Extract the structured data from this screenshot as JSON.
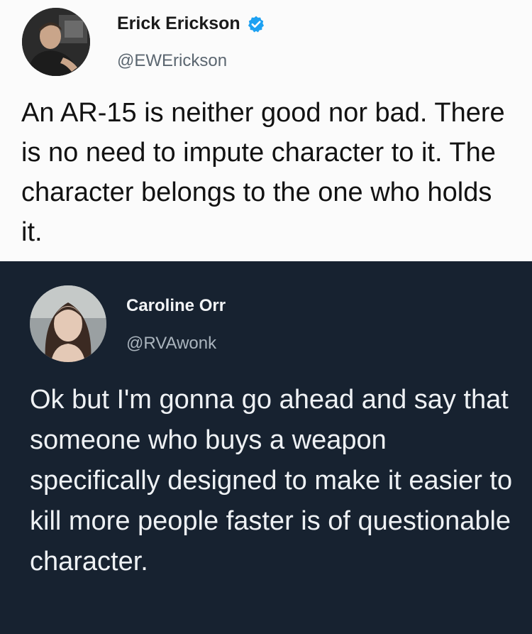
{
  "tweets": [
    {
      "display_name": "Erick Erickson",
      "verified": true,
      "handle": "@EWErickson",
      "text": "An AR-15 is neither good nor bad. There is no need to impute character to it. The character belongs to the one who holds it.",
      "theme": "light",
      "colors": {
        "background": "#fbfbfb",
        "text": "#121212",
        "handle": "#5b6670",
        "verified_badge": "#1da1f2"
      }
    },
    {
      "display_name": "Caroline Orr",
      "verified": false,
      "handle": "@RVAwonk",
      "text": "Ok but I'm gonna go ahead and say that someone who buys a weapon specifically designed to make it easier to kill more people faster is of questionable character.",
      "theme": "dark",
      "colors": {
        "background": "#172230",
        "text": "#eef1f4",
        "handle": "#aab4bd"
      }
    }
  ],
  "icons": {
    "verified": "verified-badge-icon",
    "avatar": "user-avatar"
  }
}
